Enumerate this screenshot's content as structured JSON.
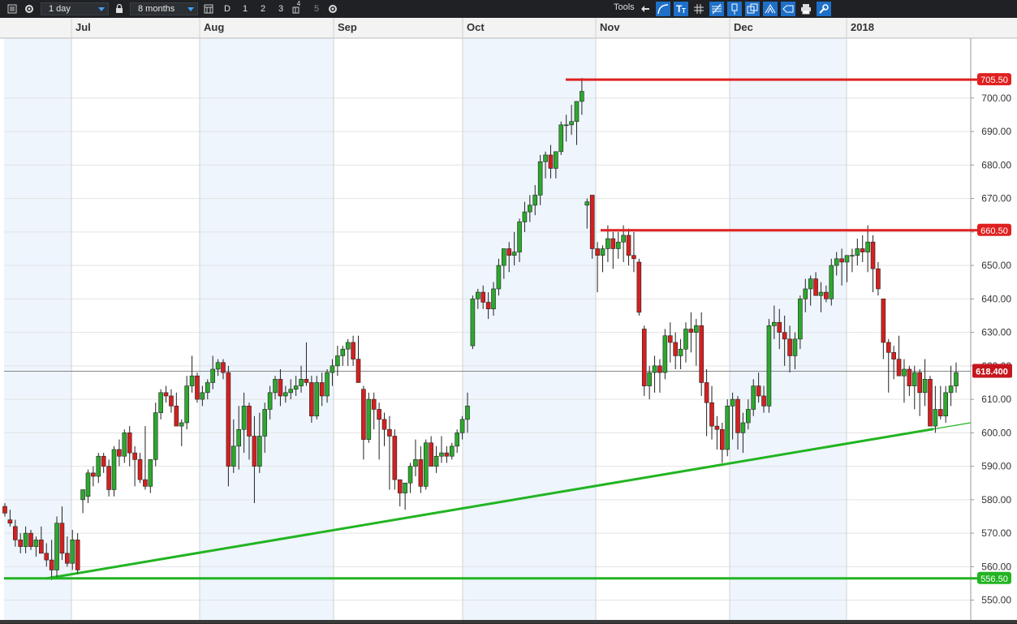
{
  "toolbar": {
    "interval": "1 day",
    "range": "8 months",
    "btn_d": "D",
    "btn_1": "1",
    "btn_2": "2",
    "btn_3": "3",
    "btn_4": "4",
    "btn_5": "5",
    "tools_label": "Tools",
    "icons": [
      "menu-icon",
      "gear-icon",
      "lock-icon",
      "calendar-icon",
      "grid-icon",
      "gear-icon",
      "back-arrow-icon",
      "curve-icon",
      "text-tool-icon",
      "crosshair-icon",
      "fib-icon",
      "pin-icon",
      "windows-icon",
      "pitchfork-icon",
      "tag-icon",
      "print-icon",
      "settings-icon"
    ],
    "accent": "#1e6fc8"
  },
  "chart_data": {
    "type": "candlestick",
    "x_ticks": [
      "Jul",
      "Aug",
      "Sep",
      "Oct",
      "Nov",
      "Dec",
      "2018"
    ],
    "ylim": [
      545,
      710
    ],
    "y_ticks": [
      "550.00",
      "560.00",
      "570.00",
      "580.00",
      "590.00",
      "600.00",
      "610.00",
      "620.00",
      "630.00",
      "640.00",
      "650.00",
      "660.00",
      "670.00",
      "680.00",
      "690.00",
      "700.00"
    ],
    "last_price": "618.400",
    "last_price_value": 618.4,
    "levels": [
      {
        "label": "705.50",
        "value": 705.5,
        "color": "#e02020"
      },
      {
        "label": "660.50",
        "value": 660.5,
        "color": "#e02020"
      },
      {
        "label": "556.50",
        "value": 556.5,
        "color": "#22b422"
      }
    ],
    "trendline": {
      "from": 556.5,
      "to": 603,
      "color": "#22b422"
    },
    "candles": [
      [
        578,
        579,
        575,
        576
      ],
      [
        574,
        577,
        572,
        573
      ],
      [
        572,
        574,
        566,
        568
      ],
      [
        568,
        570,
        564,
        566
      ],
      [
        566,
        572,
        564,
        570
      ],
      [
        570,
        571,
        565,
        566
      ],
      [
        566,
        569,
        563,
        568
      ],
      [
        568,
        572,
        565,
        564
      ],
      [
        564,
        567,
        560,
        562
      ],
      [
        562,
        568,
        556,
        559
      ],
      [
        559,
        575,
        557,
        573
      ],
      [
        573,
        578,
        562,
        564
      ],
      [
        564,
        569,
        560,
        561
      ],
      [
        561,
        571,
        559,
        568
      ],
      [
        568,
        570,
        558,
        559
      ],
      [
        580,
        581,
        576,
        583
      ],
      [
        581,
        589,
        579,
        588
      ],
      [
        588,
        590,
        584,
        587
      ],
      [
        587,
        594,
        585,
        593
      ],
      [
        593,
        594,
        588,
        590
      ],
      [
        590,
        592,
        581,
        583
      ],
      [
        583,
        596,
        581,
        595
      ],
      [
        595,
        598,
        590,
        593
      ],
      [
        593,
        601,
        591,
        600
      ],
      [
        600,
        602,
        590,
        594
      ],
      [
        594,
        596,
        584,
        592
      ],
      [
        592,
        594,
        585,
        586
      ],
      [
        586,
        602,
        583,
        584
      ],
      [
        584,
        592,
        582,
        592
      ],
      [
        592,
        609,
        590,
        606
      ],
      [
        606,
        613,
        604,
        612
      ],
      [
        612,
        614,
        609,
        611
      ],
      [
        611,
        613,
        606,
        608
      ],
      [
        608,
        612,
        603,
        602
      ],
      [
        602,
        604,
        596,
        603
      ],
      [
        603,
        617,
        601,
        614
      ],
      [
        614,
        623,
        612,
        617
      ],
      [
        617,
        618,
        609,
        610
      ],
      [
        610,
        614,
        608,
        612
      ],
      [
        612,
        616,
        610,
        615
      ],
      [
        615,
        623,
        613,
        619
      ],
      [
        619,
        622,
        617,
        621
      ],
      [
        621,
        622,
        616,
        618
      ],
      [
        618,
        620,
        584,
        590
      ],
      [
        590,
        604,
        588,
        596
      ],
      [
        596,
        608,
        589,
        601
      ],
      [
        601,
        612,
        594,
        608
      ],
      [
        608,
        609,
        592,
        599
      ],
      [
        599,
        605,
        579,
        590
      ],
      [
        590,
        606,
        588,
        599
      ],
      [
        599,
        609,
        594,
        607
      ],
      [
        607,
        614,
        604,
        612
      ],
      [
        612,
        617,
        610,
        616
      ],
      [
        616,
        619,
        608,
        611
      ],
      [
        611,
        614,
        609,
        612
      ],
      [
        612,
        616,
        610,
        613
      ],
      [
        613,
        617,
        611,
        614
      ],
      [
        614,
        620,
        612,
        616
      ],
      [
        616,
        627,
        614,
        615
      ],
      [
        615,
        617,
        603,
        605
      ],
      [
        605,
        617,
        604,
        615
      ],
      [
        615,
        618,
        608,
        611
      ],
      [
        611,
        619,
        609,
        618
      ],
      [
        618,
        622,
        614,
        620
      ],
      [
        620,
        626,
        617,
        623
      ],
      [
        623,
        626,
        620,
        625
      ],
      [
        625,
        628,
        620,
        627
      ],
      [
        627,
        629,
        620,
        622
      ],
      [
        622,
        629,
        619,
        615
      ],
      [
        613,
        614,
        592,
        598
      ],
      [
        598,
        612,
        597,
        610
      ],
      [
        610,
        612,
        601,
        607
      ],
      [
        607,
        609,
        592,
        604
      ],
      [
        604,
        606,
        596,
        601
      ],
      [
        601,
        605,
        583,
        599
      ],
      [
        599,
        601,
        583,
        586
      ],
      [
        586,
        586,
        578,
        582
      ],
      [
        582,
        584,
        577,
        585
      ],
      [
        585,
        591,
        582,
        590
      ],
      [
        590,
        598,
        587,
        592
      ],
      [
        592,
        596,
        582,
        584
      ],
      [
        584,
        598,
        583,
        597
      ],
      [
        597,
        599,
        590,
        590
      ],
      [
        590,
        596,
        588,
        593
      ],
      [
        593,
        599,
        591,
        594
      ],
      [
        594,
        596,
        591,
        593
      ],
      [
        593,
        597,
        592,
        596
      ],
      [
        596,
        601,
        594,
        600
      ],
      [
        600,
        605,
        598,
        604
      ],
      [
        604,
        612,
        600,
        608
      ],
      [
        626,
        641,
        625,
        640
      ],
      [
        640,
        643,
        637,
        642
      ],
      [
        642,
        644,
        637,
        639
      ],
      [
        639,
        642,
        634,
        637
      ],
      [
        637,
        645,
        635,
        643
      ],
      [
        643,
        652,
        641,
        650
      ],
      [
        650,
        654,
        646,
        655
      ],
      [
        655,
        657,
        648,
        653
      ],
      [
        653,
        660,
        650,
        654
      ],
      [
        654,
        664,
        651,
        663
      ],
      [
        663,
        669,
        660,
        666
      ],
      [
        666,
        671,
        663,
        668
      ],
      [
        668,
        674,
        665,
        671
      ],
      [
        671,
        683,
        668,
        681
      ],
      [
        681,
        684,
        676,
        683
      ],
      [
        683,
        686,
        676,
        679
      ],
      [
        679,
        684,
        676,
        684
      ],
      [
        684,
        693,
        683,
        692
      ],
      [
        692,
        695,
        687,
        692
      ],
      [
        692,
        698,
        689,
        693
      ],
      [
        693,
        696,
        686,
        699
      ],
      [
        699,
        706,
        695,
        702
      ],
      [
        668,
        670,
        661,
        669
      ],
      [
        671,
        671,
        652,
        655
      ],
      [
        655,
        657,
        642,
        653
      ],
      [
        653,
        656,
        648,
        655
      ],
      [
        655,
        662,
        651,
        658
      ],
      [
        658,
        660,
        649,
        655
      ],
      [
        655,
        660,
        652,
        657
      ],
      [
        657,
        662,
        651,
        659
      ],
      [
        659,
        661,
        650,
        653
      ],
      [
        653,
        660,
        648,
        652
      ],
      [
        651,
        652,
        635,
        636
      ],
      [
        631,
        632,
        611,
        614
      ],
      [
        614,
        620,
        610,
        618
      ],
      [
        618,
        623,
        612,
        620
      ],
      [
        620,
        622,
        612,
        618
      ],
      [
        618,
        631,
        616,
        629
      ],
      [
        629,
        633,
        621,
        627
      ],
      [
        627,
        630,
        619,
        623
      ],
      [
        623,
        628,
        619,
        625
      ],
      [
        625,
        633,
        621,
        631
      ],
      [
        631,
        636,
        624,
        630
      ],
      [
        630,
        634,
        620,
        632
      ],
      [
        632,
        636,
        611,
        615
      ],
      [
        615,
        619,
        599,
        609
      ],
      [
        609,
        614,
        598,
        602
      ],
      [
        602,
        605,
        595,
        601
      ],
      [
        601,
        603,
        591,
        595
      ],
      [
        595,
        610,
        593,
        608
      ],
      [
        608,
        612,
        598,
        610
      ],
      [
        610,
        611,
        595,
        600
      ],
      [
        600,
        606,
        594,
        603
      ],
      [
        603,
        610,
        601,
        607
      ],
      [
        607,
        616,
        605,
        614
      ],
      [
        614,
        618,
        609,
        611
      ],
      [
        611,
        614,
        606,
        608
      ],
      [
        608,
        634,
        606,
        632
      ],
      [
        632,
        638,
        628,
        633
      ],
      [
        633,
        637,
        625,
        630
      ],
      [
        630,
        635,
        620,
        628
      ],
      [
        628,
        632,
        618,
        623
      ],
      [
        623,
        630,
        619,
        628
      ],
      [
        628,
        641,
        625,
        640
      ],
      [
        640,
        646,
        636,
        643
      ],
      [
        643,
        647,
        638,
        646
      ],
      [
        646,
        648,
        642,
        641
      ],
      [
        641,
        645,
        636,
        642
      ],
      [
        642,
        644,
        639,
        640
      ],
      [
        640,
        652,
        638,
        650
      ],
      [
        650,
        654,
        647,
        652
      ],
      [
        652,
        655,
        644,
        651
      ],
      [
        651,
        652,
        645,
        653
      ],
      [
        653,
        655,
        648,
        653
      ],
      [
        653,
        658,
        650,
        655
      ],
      [
        655,
        659,
        651,
        654
      ],
      [
        654,
        662,
        648,
        657
      ],
      [
        657,
        659,
        642,
        649
      ],
      [
        649,
        651,
        641,
        643
      ],
      [
        640,
        640,
        622,
        627
      ],
      [
        627,
        628,
        612,
        624
      ],
      [
        624,
        626,
        616,
        622
      ],
      [
        622,
        629,
        619,
        617
      ],
      [
        617,
        622,
        609,
        619
      ],
      [
        619,
        620,
        611,
        614
      ],
      [
        614,
        620,
        607,
        618
      ],
      [
        618,
        619,
        605,
        612
      ],
      [
        612,
        622,
        608,
        616
      ],
      [
        616,
        617,
        605,
        602
      ],
      [
        602,
        614,
        600,
        607
      ],
      [
        607,
        614,
        604,
        605
      ],
      [
        605,
        614,
        603,
        612
      ],
      [
        612,
        620,
        608,
        614
      ],
      [
        614,
        621,
        612,
        618
      ]
    ]
  }
}
